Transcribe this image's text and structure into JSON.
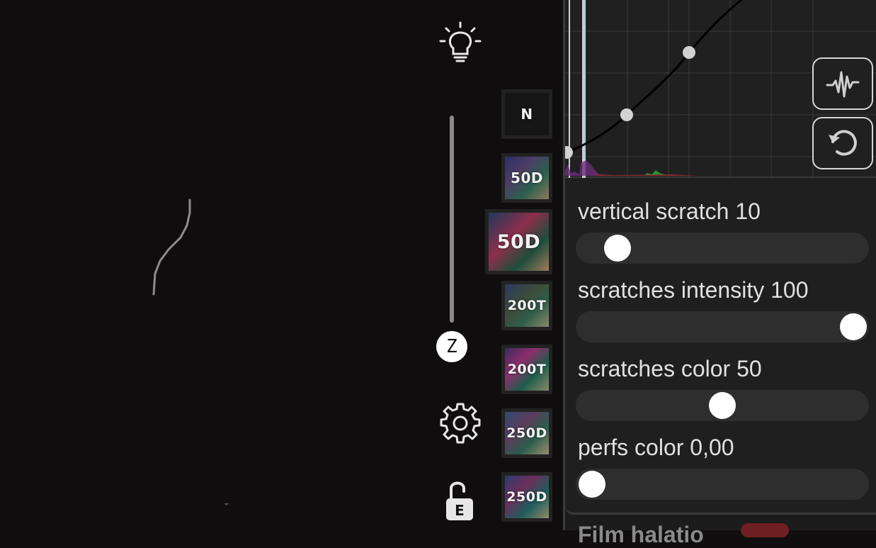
{
  "film_tiles": [
    {
      "label": "N"
    },
    {
      "label": "50D"
    },
    {
      "label": "50D"
    },
    {
      "label": "200T"
    },
    {
      "label": "200T"
    },
    {
      "label": "250D"
    },
    {
      "label": "250D"
    }
  ],
  "zoom_knob": {
    "label": "Z"
  },
  "lock": {
    "label": "E"
  },
  "controls": [
    {
      "label": "vertical scratch 10",
      "value": 10,
      "max": 100
    },
    {
      "label": "scratches intensity 100",
      "value": 100,
      "max": 100
    },
    {
      "label": "scratches color 50",
      "value": 50,
      "max": 100
    },
    {
      "label": "perfs color 0,00",
      "value": 0,
      "max": 1
    }
  ],
  "section_partial": {
    "label": "Film halatio"
  },
  "colors": {
    "accent": "#ffffff",
    "panel": "#1f1f1f",
    "badge": "#6e1f22"
  }
}
